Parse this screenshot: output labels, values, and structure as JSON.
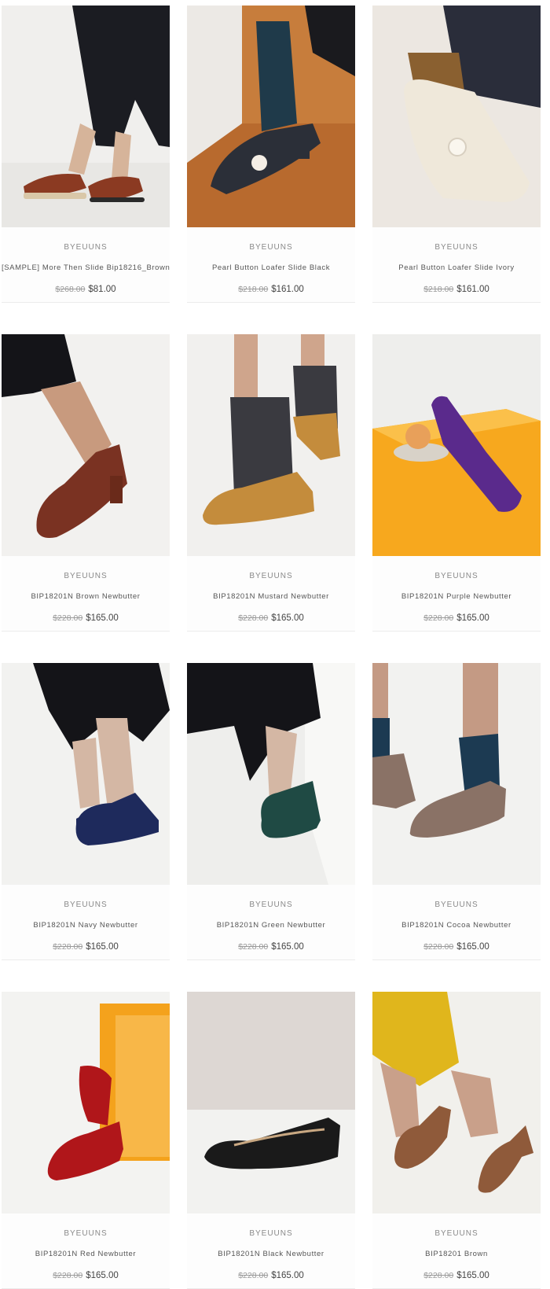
{
  "products": [
    {
      "vendor": "BYEUUNS",
      "title": "[SAMPLE] More Then Slide Bip18216_Brown",
      "compare_price": "$268.00",
      "price": "$81.00",
      "scene": "slide-brown"
    },
    {
      "vendor": "BYEUUNS",
      "title": "Pearl Button Loafer Slide Black",
      "compare_price": "$218.00",
      "price": "$161.00",
      "scene": "loafer-black"
    },
    {
      "vendor": "BYEUUNS",
      "title": "Pearl Button Loafer Slide Ivory",
      "compare_price": "$218.00",
      "price": "$161.00",
      "scene": "loafer-ivory"
    },
    {
      "vendor": "BYEUUNS",
      "title": "BIP18201N Brown Newbutter",
      "compare_price": "$228.00",
      "price": "$165.00",
      "scene": "pump-brown"
    },
    {
      "vendor": "BYEUUNS",
      "title": "BIP18201N Mustard Newbutter",
      "compare_price": "$228.00",
      "price": "$165.00",
      "scene": "pump-mustard"
    },
    {
      "vendor": "BYEUUNS",
      "title": "BIP18201N Purple Newbutter",
      "compare_price": "$228.00",
      "price": "$165.00",
      "scene": "pump-purple"
    },
    {
      "vendor": "BYEUUNS",
      "title": "BIP18201N Navy Newbutter",
      "compare_price": "$228.00",
      "price": "$165.00",
      "scene": "pump-navy"
    },
    {
      "vendor": "BYEUUNS",
      "title": "BIP18201N Green Newbutter",
      "compare_price": "$228.00",
      "price": "$165.00",
      "scene": "pump-green"
    },
    {
      "vendor": "BYEUUNS",
      "title": "BIP18201N Cocoa Newbutter",
      "compare_price": "$228.00",
      "price": "$165.00",
      "scene": "pump-cocoa"
    },
    {
      "vendor": "BYEUUNS",
      "title": "BIP18201N Red Newbutter",
      "compare_price": "$228.00",
      "price": "$165.00",
      "scene": "pump-red"
    },
    {
      "vendor": "BYEUUNS",
      "title": "BIP18201N Black Newbutter",
      "compare_price": "$228.00",
      "price": "$165.00",
      "scene": "flat-black"
    },
    {
      "vendor": "BYEUUNS",
      "title": "BIP18201 Brown",
      "compare_price": "$228.00",
      "price": "$165.00",
      "scene": "pump-tan"
    }
  ],
  "colors": {
    "slide-brown": "#8b3a22",
    "loafer-black": "#2b2f38",
    "loafer-ivory": "#efe8da",
    "pump-brown": "#7a3222",
    "pump-mustard": "#c48c3c",
    "pump-purple": "#5a2a8c",
    "pump-navy": "#1e2a5c",
    "pump-green": "#1f4a44",
    "pump-cocoa": "#8a7266",
    "pump-red": "#b0161a",
    "flat-black": "#1a1a1a",
    "pump-tan": "#8f5a3a"
  }
}
